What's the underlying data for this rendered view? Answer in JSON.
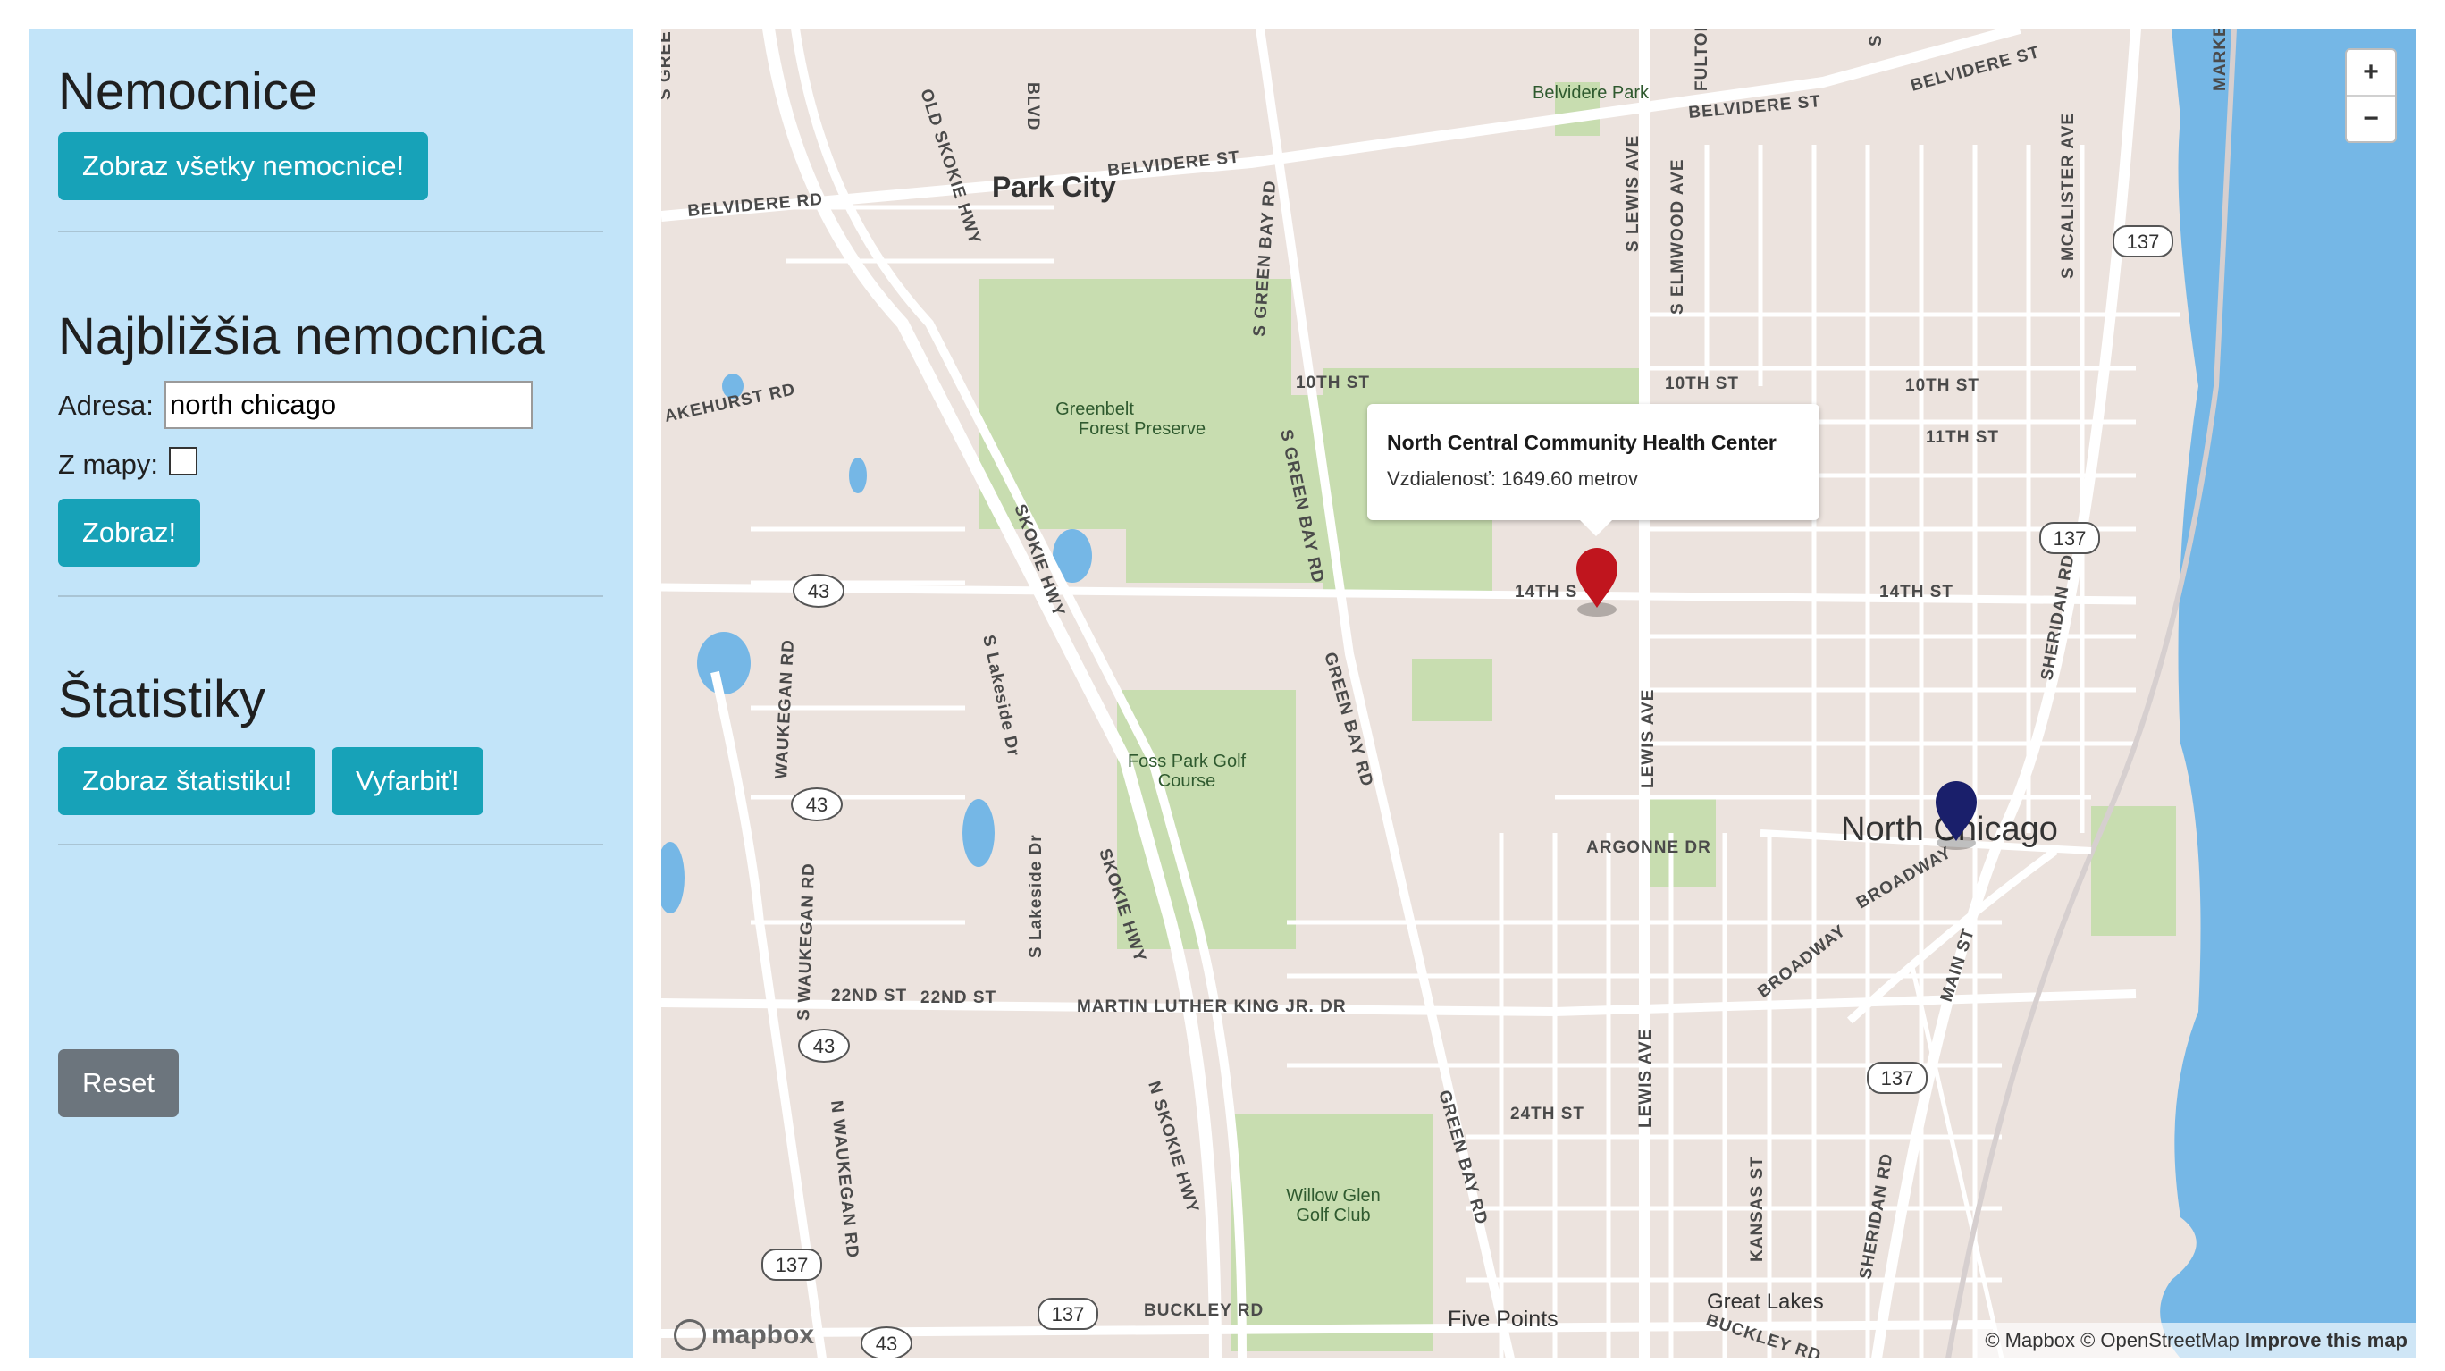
{
  "sidebar": {
    "hospitals": {
      "title": "Nemocnice",
      "show_all_button": "Zobraz všetky nemocnice!"
    },
    "nearest": {
      "title": "Najbližšia nemocnica",
      "address_label": "Adresa:",
      "address_value": "north chicago",
      "from_map_label": "Z mapy:",
      "from_map_checked": false,
      "show_button": "Zobraz!"
    },
    "stats": {
      "title": "Štatistiky",
      "show_stats_button": "Zobraz štatistiku!",
      "color_button": "Vyfarbiť!"
    },
    "reset_button": "Reset",
    "background_color": "#c2e4f9",
    "button_color": "#17a2b8"
  },
  "map": {
    "zoom_in": "+",
    "zoom_out": "−",
    "popup": {
      "title": "North Central Community Health Center",
      "distance_label": "Vzdialenosť:",
      "distance_value": "1649.60 metrov"
    },
    "attribution": {
      "mapbox": "© Mapbox",
      "osm": "© OpenStreetMap",
      "improve": "Improve this map"
    },
    "logo": "mapbox",
    "colors": {
      "water": "#75b7e6",
      "park": "#c8ddb0",
      "land": "#ece3de",
      "red_marker": "#c0151e",
      "blue_marker": "#1a1f6b"
    },
    "labels": {
      "park_city": "Park City",
      "north_chicago": "North Chicago",
      "five_points": "Five Points",
      "great_lakes": "Great Lakes",
      "belvidere_park": "Belvidere Park",
      "greenbelt": "Greenbelt",
      "forest_preserve": "Forest Preserve",
      "foss_park": "Foss Park Golf",
      "course": "Course",
      "willow_glen": "Willow Glen",
      "golf_club": "Golf Club",
      "belvidere_rd": "BELVIDERE RD",
      "belvidere_st": "BELVIDERE ST",
      "belvidere_st2": "BELVIDERE ST",
      "belvidere_st3": "BELVIDERE ST",
      "tenth_st": "10TH ST",
      "tenth_st2": "10TH ST",
      "tenth_st3": "10TH ST",
      "eleventh_st": "11TH ST",
      "fourteenth_st": "14TH S",
      "fourteenth_st2": "14TH ST",
      "argonne": "ARGONNE DR",
      "mlk": "MARTIN LUTHER KING JR. DR",
      "twentysecond": "22ND ST",
      "twentysecond2": "22ND ST",
      "twentyfourth": "24TH ST",
      "buckley": "BUCKLEY RD",
      "buckley2": "BUCKLEY RD",
      "skokie": "SKOKIE HWY",
      "skokie2": "SKOKIE HWY",
      "n_skokie": "N SKOKIE HWY",
      "old_skokie": "OLD SKOKIE HWY",
      "green_bay": "S GREEN BAY RD",
      "green_bay2": "S GREEN BAY RD",
      "green_bay3": "GREEN BAY RD",
      "green_bay4": "GREEN BAY RD",
      "waukegan": "WAUKEGAN RD",
      "s_waukegan": "S WAUKEGAN RD",
      "n_waukegan": "N WAUKEGAN RD",
      "lewis": "S LEWIS AVE",
      "lewis2": "LEWIS AVE",
      "lewis3": "LEWIS AVE",
      "elmwood": "S ELMWOOD AVE",
      "mcalister": "S MCALISTER AVE",
      "sheridan": "SHERIDAN RD",
      "sheridan2": "SHERIDAN RD",
      "broadway": "BROADWAY",
      "broadway2": "BROADWAY",
      "main": "MAIN ST",
      "kansas": "KANSAS ST",
      "lakeside": "S Lakeside Dr",
      "lakeside2": "S Lakeside Dr",
      "akehurst": "AKEHURST RD",
      "fulton": "FULTON",
      "blvd": "BLVD",
      "marke": "MARKE",
      "s_green": "S GREEN",
      "s_short": "S",
      "hwy43": "43",
      "hwy137": "137"
    }
  }
}
